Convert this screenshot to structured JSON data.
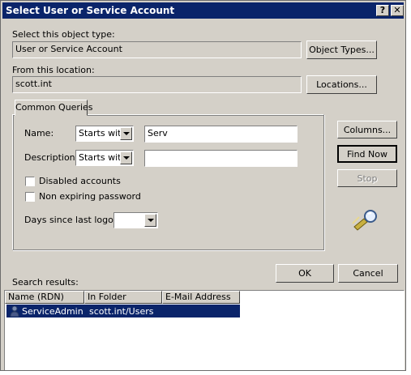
{
  "window": {
    "title": "Select User or Service Account",
    "help_button": "?",
    "close_button": "✕"
  },
  "object_type": {
    "label": "Select this object type:",
    "value": "User or Service Account",
    "button": "Object Types..."
  },
  "location": {
    "label": "From this location:",
    "value": "scott.int",
    "button": "Locations..."
  },
  "query": {
    "tab_label": "Common Queries",
    "name_label": "Name:",
    "name_operator": "Starts with",
    "name_value": "Serv",
    "description_label": "Description:",
    "description_operator": "Starts with",
    "description_value": "",
    "disabled_accounts_label": "Disabled accounts",
    "disabled_accounts_checked": false,
    "non_expiring_label": "Non expiring password",
    "non_expiring_checked": false,
    "days_label": "Days since last logon:",
    "days_value": ""
  },
  "side_buttons": {
    "columns": "Columns...",
    "find_now": "Find Now",
    "stop": "Stop"
  },
  "dialog_buttons": {
    "ok": "OK",
    "cancel": "Cancel"
  },
  "results": {
    "label": "Search results:",
    "columns": [
      "Name (RDN)",
      "In Folder",
      "E-Mail Address"
    ],
    "rows": [
      {
        "name": "ServiceAdmin",
        "folder": "scott.int/Users",
        "email": "",
        "selected": true,
        "icon": "user-icon"
      }
    ]
  },
  "colors": {
    "titlebar": "#0a246a",
    "face": "#d4d0c8",
    "selection": "#0a246a"
  }
}
